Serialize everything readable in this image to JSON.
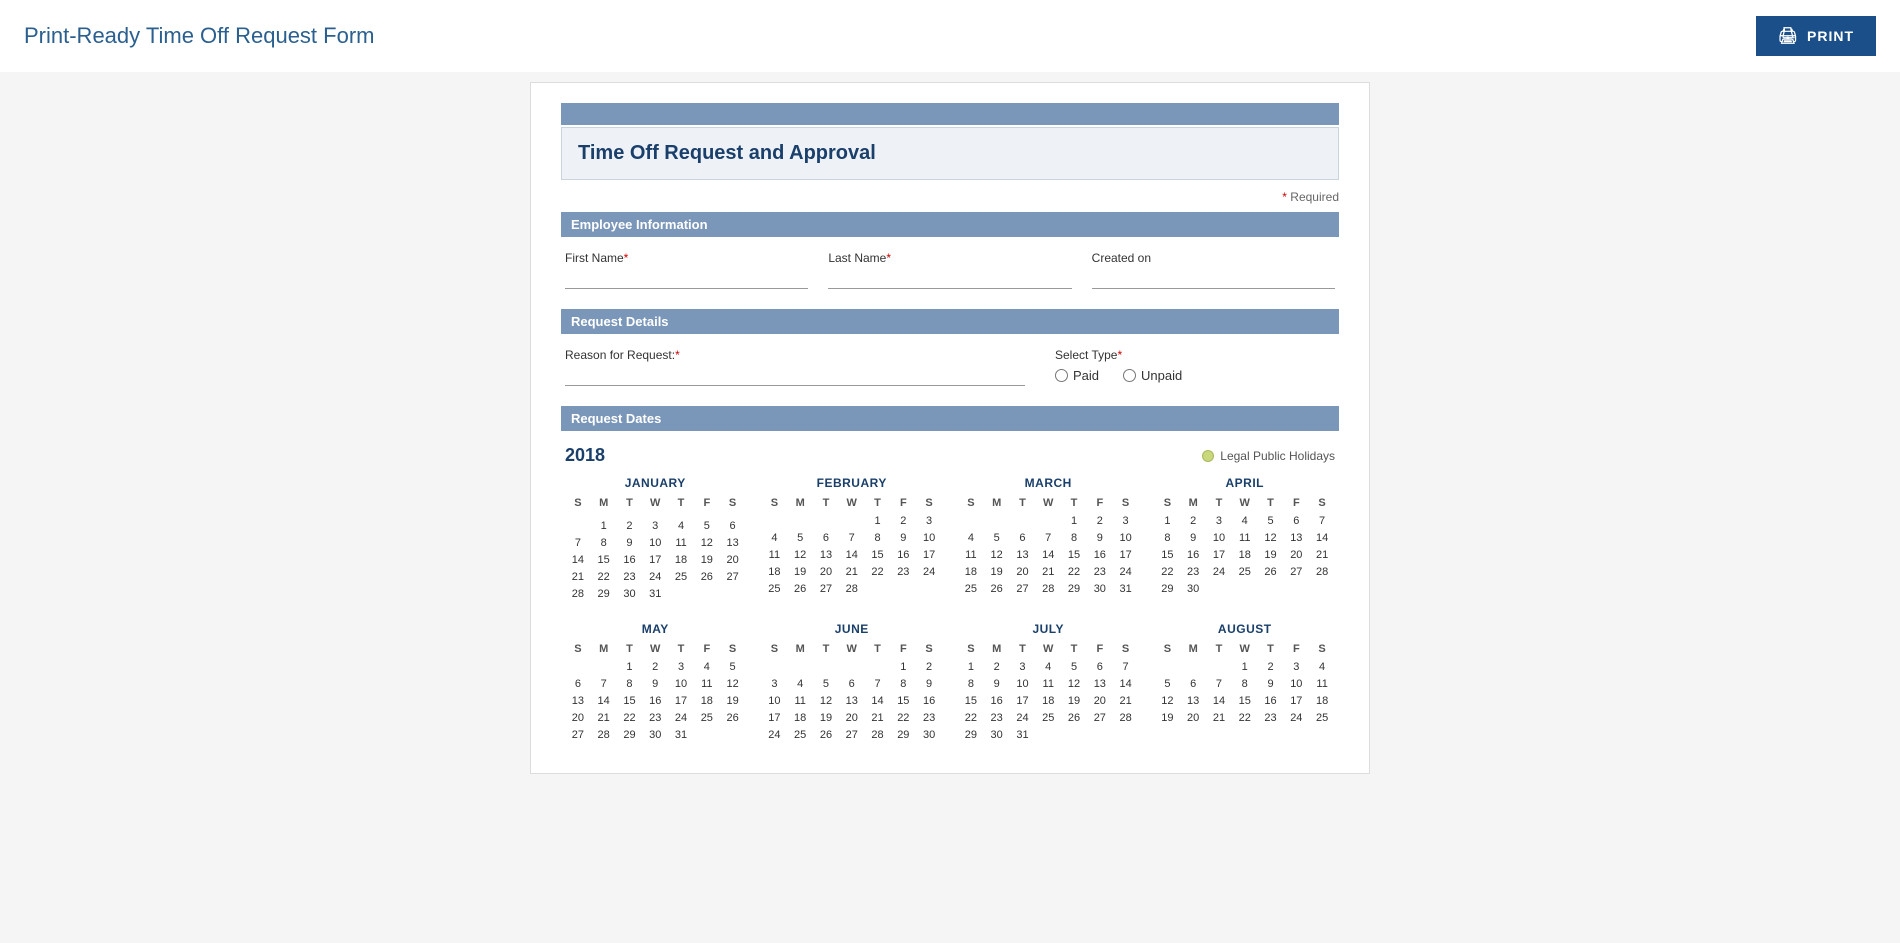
{
  "header": {
    "page_title": "Print-Ready Time Off Request Form",
    "print_button_label": "PRINT"
  },
  "form": {
    "header_bar": "",
    "title": "Time Off Request and Approval",
    "required_note": "* Required",
    "sections": {
      "employee_info": {
        "label": "Employee Information",
        "fields": {
          "first_name": {
            "label": "First Name",
            "required": true,
            "placeholder": ""
          },
          "last_name": {
            "label": "Last Name",
            "required": true,
            "placeholder": ""
          },
          "created_on": {
            "label": "Created on",
            "required": false,
            "placeholder": ""
          }
        }
      },
      "request_details": {
        "label": "Request Details",
        "reason_label": "Reason for Request:",
        "reason_required": true,
        "select_type_label": "Select Type",
        "select_type_required": true,
        "options": [
          "Paid",
          "Unpaid"
        ]
      },
      "request_dates": {
        "label": "Request Dates",
        "year": "2018",
        "legend_label": "Legal Public Holidays"
      }
    }
  },
  "calendars": [
    {
      "month": "JANUARY",
      "weeks": [
        [
          "",
          "",
          "",
          "",
          "",
          "",
          ""
        ],
        [
          "",
          "1*",
          "2",
          "3",
          "4",
          "5",
          "6"
        ],
        [
          "7",
          "8",
          "9",
          "10",
          "11",
          "12",
          "13"
        ],
        [
          "14",
          "15*",
          "16",
          "17",
          "18",
          "19",
          "20"
        ],
        [
          "21",
          "22",
          "23",
          "24",
          "25",
          "26",
          "27"
        ],
        [
          "28",
          "29",
          "30",
          "31",
          "",
          "",
          ""
        ]
      ],
      "highlights": [
        "1",
        "15"
      ]
    },
    {
      "month": "FEBRUARY",
      "weeks": [
        [
          "",
          "",
          "",
          "",
          "1",
          "2",
          "3"
        ],
        [
          "4",
          "5",
          "6",
          "7",
          "8",
          "9",
          "10"
        ],
        [
          "11",
          "12",
          "13",
          "14",
          "15",
          "16",
          "17"
        ],
        [
          "18",
          "19*",
          "20",
          "21",
          "22",
          "23",
          "24"
        ],
        [
          "25",
          "26",
          "27",
          "28",
          "",
          "",
          ""
        ]
      ],
      "highlights": [
        "19"
      ]
    },
    {
      "month": "MARCH",
      "weeks": [
        [
          "",
          "",
          "",
          "",
          "1",
          "2",
          "3"
        ],
        [
          "4",
          "5",
          "6",
          "7",
          "8",
          "9",
          "10"
        ],
        [
          "11",
          "12",
          "13",
          "14",
          "15",
          "16",
          "17"
        ],
        [
          "18",
          "19",
          "20",
          "21",
          "22",
          "23",
          "24"
        ],
        [
          "25",
          "26",
          "27",
          "28",
          "29",
          "30",
          "31"
        ]
      ],
      "highlights": []
    },
    {
      "month": "APRIL",
      "weeks": [
        [
          "1",
          "2",
          "3",
          "4",
          "5",
          "6",
          "7"
        ],
        [
          "8",
          "9",
          "10",
          "11",
          "12",
          "13",
          "14"
        ],
        [
          "15",
          "16",
          "17",
          "18",
          "19",
          "20",
          "21"
        ],
        [
          "22",
          "23",
          "24",
          "25",
          "26",
          "27",
          "28"
        ],
        [
          "29",
          "30",
          "",
          "",
          "",
          "",
          ""
        ]
      ],
      "highlights": []
    },
    {
      "month": "MAY",
      "weeks": [
        [
          "",
          "",
          "1",
          "2",
          "3",
          "4",
          "5"
        ],
        [
          "6",
          "7",
          "8",
          "9",
          "10",
          "11",
          "12"
        ],
        [
          "13",
          "14",
          "15",
          "16",
          "17",
          "18",
          "19"
        ],
        [
          "20",
          "21",
          "22",
          "23",
          "24",
          "25",
          "26"
        ],
        [
          "27",
          "28",
          "29",
          "30",
          "31",
          "",
          ""
        ]
      ],
      "highlights": []
    },
    {
      "month": "JUNE",
      "weeks": [
        [
          "",
          "",
          "",
          "",
          "",
          "1",
          "2"
        ],
        [
          "3",
          "4",
          "5",
          "6",
          "7",
          "8",
          "9"
        ],
        [
          "10",
          "11",
          "12",
          "13",
          "14",
          "15",
          "16"
        ],
        [
          "17",
          "18",
          "19",
          "20",
          "21",
          "22",
          "23"
        ],
        [
          "24",
          "25",
          "26",
          "27",
          "28",
          "29",
          "30"
        ]
      ],
      "highlights": []
    },
    {
      "month": "JULY",
      "weeks": [
        [
          "1",
          "2",
          "3",
          "4*",
          "5",
          "6",
          "7"
        ],
        [
          "8",
          "9",
          "10",
          "11",
          "12",
          "13",
          "14"
        ],
        [
          "15",
          "16",
          "17",
          "18",
          "19",
          "20",
          "21"
        ],
        [
          "22",
          "23",
          "24",
          "25",
          "26",
          "27",
          "28"
        ],
        [
          "29",
          "30",
          "31",
          "",
          "",
          "",
          ""
        ]
      ],
      "highlights": [
        "4"
      ]
    },
    {
      "month": "AUGUST",
      "weeks": [
        [
          "",
          "",
          "",
          "1",
          "2",
          "3",
          "4"
        ],
        [
          "5",
          "6",
          "7",
          "8",
          "9",
          "10",
          "11"
        ],
        [
          "12",
          "13",
          "14",
          "15",
          "16",
          "17",
          "18"
        ],
        [
          "19",
          "20",
          "21",
          "22",
          "23",
          "24",
          "25"
        ]
      ],
      "highlights": []
    }
  ]
}
